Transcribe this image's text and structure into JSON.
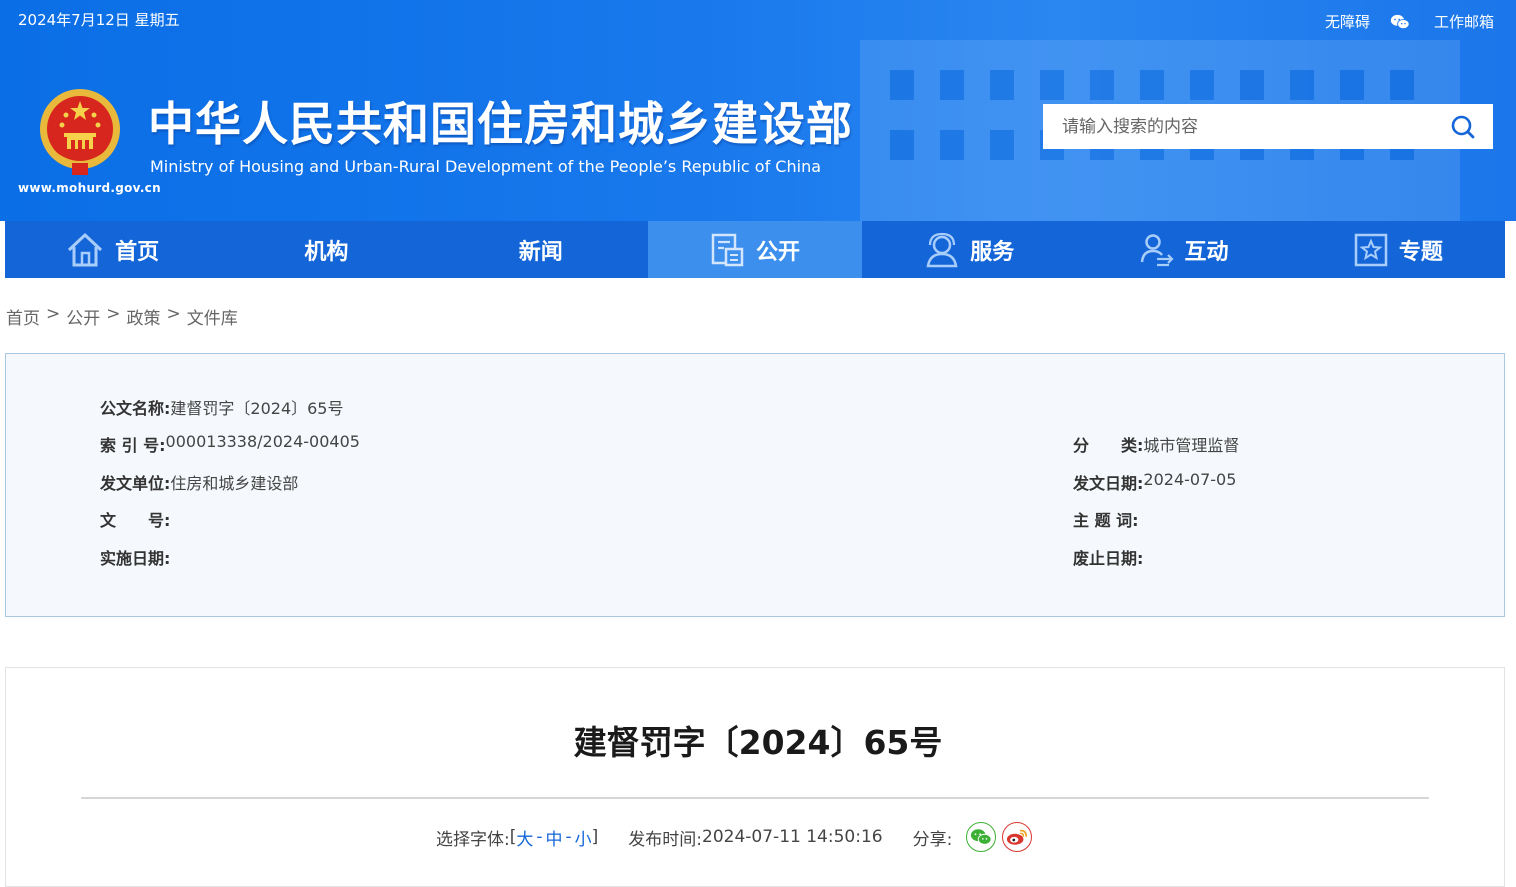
{
  "header": {
    "date": "2024年7月12日 星期五",
    "accessibility_link": "无障碍",
    "mail_link": "工作邮箱",
    "site_url": "www.mohurd.gov.cn",
    "title": "中华人民共和国住房和城乡建设部",
    "subtitle": "Ministry of Housing and Urban-Rural Development of the People’s Republic of China",
    "search_placeholder": "请输入搜索的内容"
  },
  "nav": {
    "items": [
      {
        "label": "首页",
        "icon": "home-icon"
      },
      {
        "label": "机构",
        "icon": ""
      },
      {
        "label": "新闻",
        "icon": ""
      },
      {
        "label": "公开",
        "icon": "document-icon",
        "active": true
      },
      {
        "label": "服务",
        "icon": "service-icon"
      },
      {
        "label": "互动",
        "icon": "interaction-icon"
      },
      {
        "label": "专题",
        "icon": "star-icon"
      }
    ],
    "active_color": "#3d8fed",
    "bar_color": "#1466d8"
  },
  "breadcrumb": [
    "首页",
    "公开",
    "政策",
    "文件库"
  ],
  "breadcrumb_sep": ">",
  "info": {
    "doc_name_label": "公文名称:",
    "doc_name": "建督罚字〔2024〕65号",
    "index_label": "索 引 号:",
    "index": "000013338/2024-00405",
    "category_label": "分　　类:",
    "category": "城市管理监督",
    "issuer_label": "发文单位:",
    "issuer": "住房和城乡建设部",
    "issue_date_label": "发文日期:",
    "issue_date": "2024-07-05",
    "doc_no_label": "文　　号:",
    "doc_no": "",
    "keywords_label": "主 题 词:",
    "keywords": "",
    "effective_label": "实施日期:",
    "effective": "",
    "abolish_label": "废止日期:",
    "abolish": ""
  },
  "article": {
    "title": "建督罚字〔2024〕65号",
    "font_select_label": "选择字体:",
    "bracket_open": "[",
    "font_large": "大",
    "font_medium": "中",
    "font_small": "小",
    "bracket_close": "]",
    "dash": "-",
    "publish_label": "发布时间:",
    "publish_time": "2024-07-11 14:50:16",
    "share_label": "分享:"
  }
}
